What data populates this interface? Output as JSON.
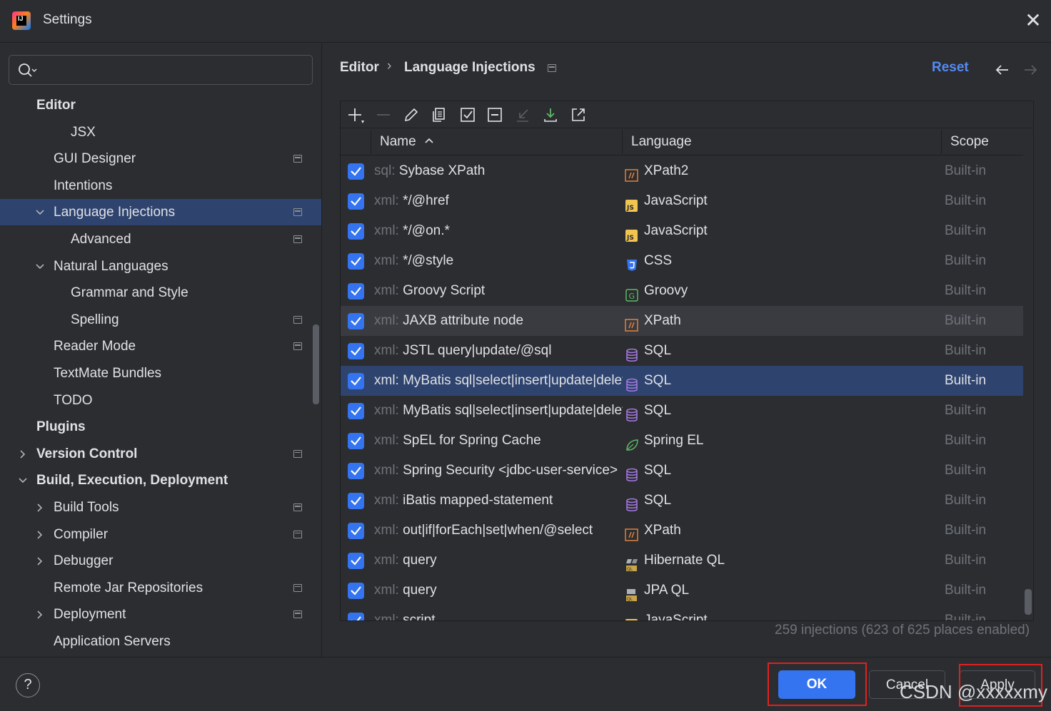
{
  "window": {
    "title": "Settings",
    "logo_text": "IJ",
    "close_glyph": "✕"
  },
  "search": {
    "placeholder": "",
    "value": ""
  },
  "sidebar": {
    "items": [
      {
        "label": "Editor",
        "bold": true,
        "indent": 0,
        "arrow": "none",
        "project": false
      },
      {
        "label": "JSX",
        "bold": false,
        "indent": 2,
        "arrow": "none",
        "project": false
      },
      {
        "label": "GUI Designer",
        "bold": false,
        "indent": 1,
        "arrow": "none",
        "project": true
      },
      {
        "label": "Intentions",
        "bold": false,
        "indent": 1,
        "arrow": "none",
        "project": false
      },
      {
        "label": "Language Injections",
        "bold": false,
        "indent": 1,
        "arrow": "down",
        "project": true,
        "selected": true
      },
      {
        "label": "Advanced",
        "bold": false,
        "indent": 2,
        "arrow": "none",
        "project": true
      },
      {
        "label": "Natural Languages",
        "bold": false,
        "indent": 1,
        "arrow": "down",
        "project": false
      },
      {
        "label": "Grammar and Style",
        "bold": false,
        "indent": 2,
        "arrow": "none",
        "project": false
      },
      {
        "label": "Spelling",
        "bold": false,
        "indent": 2,
        "arrow": "none",
        "project": true
      },
      {
        "label": "Reader Mode",
        "bold": false,
        "indent": 1,
        "arrow": "none",
        "project": true
      },
      {
        "label": "TextMate Bundles",
        "bold": false,
        "indent": 1,
        "arrow": "none",
        "project": false
      },
      {
        "label": "TODO",
        "bold": false,
        "indent": 1,
        "arrow": "none",
        "project": false
      },
      {
        "label": "Plugins",
        "bold": true,
        "indent": 0,
        "arrow": "none",
        "project": false
      },
      {
        "label": "Version Control",
        "bold": true,
        "indent": 0,
        "arrow": "right",
        "project": true
      },
      {
        "label": "Build, Execution, Deployment",
        "bold": true,
        "indent": 0,
        "arrow": "down",
        "project": false
      },
      {
        "label": "Build Tools",
        "bold": false,
        "indent": 1,
        "arrow": "right",
        "project": true
      },
      {
        "label": "Compiler",
        "bold": false,
        "indent": 1,
        "arrow": "right",
        "project": true
      },
      {
        "label": "Debugger",
        "bold": false,
        "indent": 1,
        "arrow": "right",
        "project": false
      },
      {
        "label": "Remote Jar Repositories",
        "bold": false,
        "indent": 1,
        "arrow": "none",
        "project": true
      },
      {
        "label": "Deployment",
        "bold": false,
        "indent": 1,
        "arrow": "right",
        "project": true
      },
      {
        "label": "Application Servers",
        "bold": false,
        "indent": 1,
        "arrow": "none",
        "project": false
      }
    ]
  },
  "breadcrumb": {
    "parent": "Editor",
    "separator": "›",
    "current": "Language Injections"
  },
  "header": {
    "reset_label": "Reset"
  },
  "toolbar": {
    "buttons": [
      "add-icon",
      "remove-icon",
      "edit-icon",
      "copy-icon",
      "enable-all-icon",
      "disable-all-icon",
      "import-icon",
      "download-icon",
      "export-icon"
    ]
  },
  "table": {
    "columns": {
      "name": "Name",
      "name_sort_glyph": "^",
      "language": "Language",
      "scope": "Scope"
    },
    "rows": [
      {
        "prefix": "sql:",
        "name": " Sybase XPath",
        "icon": "xpath-icon",
        "language": "XPath2",
        "scope": "Built-in"
      },
      {
        "prefix": "xml:",
        "name": " */@href",
        "icon": "javascript-icon",
        "language": "JavaScript",
        "scope": "Built-in"
      },
      {
        "prefix": "xml:",
        "name": " */@on.*",
        "icon": "javascript-icon",
        "language": "JavaScript",
        "scope": "Built-in"
      },
      {
        "prefix": "xml:",
        "name": " */@style",
        "icon": "css-icon",
        "language": "CSS",
        "scope": "Built-in"
      },
      {
        "prefix": "xml:",
        "name": " Groovy Script",
        "icon": "groovy-icon",
        "language": "Groovy",
        "scope": "Built-in"
      },
      {
        "prefix": "xml:",
        "name": " JAXB attribute node",
        "icon": "xpath-icon",
        "language": "XPath",
        "scope": "Built-in",
        "hover": true
      },
      {
        "prefix": "xml:",
        "name": " JSTL query|update/@sql",
        "icon": "sql-icon",
        "language": "SQL",
        "scope": "Built-in"
      },
      {
        "prefix": "xml:",
        "name": " MyBatis sql|select|insert|update|delete",
        "icon": "sql-icon",
        "language": "SQL",
        "scope": "Built-in",
        "selected": true
      },
      {
        "prefix": "xml:",
        "name": " MyBatis sql|select|insert|update|delete",
        "icon": "sql-icon",
        "language": "SQL",
        "scope": "Built-in"
      },
      {
        "prefix": "xml:",
        "name": " SpEL for Spring Cache",
        "icon": "spring-icon",
        "language": "Spring EL",
        "scope": "Built-in"
      },
      {
        "prefix": "xml:",
        "name": " Spring Security <jdbc-user-service>",
        "icon": "sql-icon",
        "language": "SQL",
        "scope": "Built-in"
      },
      {
        "prefix": "xml:",
        "name": " iBatis mapped-statement",
        "icon": "sql-icon",
        "language": "SQL",
        "scope": "Built-in"
      },
      {
        "prefix": "xml:",
        "name": " out|if|forEach|set|when/@select",
        "icon": "xpath-icon",
        "language": "XPath",
        "scope": "Built-in"
      },
      {
        "prefix": "xml:",
        "name": " query",
        "icon": "hibernate-icon",
        "language": "Hibernate QL",
        "scope": "Built-in"
      },
      {
        "prefix": "xml:",
        "name": " query",
        "icon": "jpa-icon",
        "language": "JPA QL",
        "scope": "Built-in"
      },
      {
        "prefix": "xml:",
        "name": " script",
        "icon": "javascript-icon",
        "language": "JavaScript",
        "scope": "Built-in"
      }
    ]
  },
  "status": {
    "text": "259 injections (623 of 625 places enabled)"
  },
  "footer": {
    "help_glyph": "?",
    "ok_label": "OK",
    "cancel_label": "Cancel",
    "apply_label": "Apply",
    "watermark": "CSDN @xxxxxmy"
  },
  "colors": {
    "background": "#2b2d30",
    "selection": "#2e436e",
    "accent": "#3574f0",
    "link": "#548af7",
    "muted_text": "#6f737a",
    "annotation_red": "#e02020"
  }
}
